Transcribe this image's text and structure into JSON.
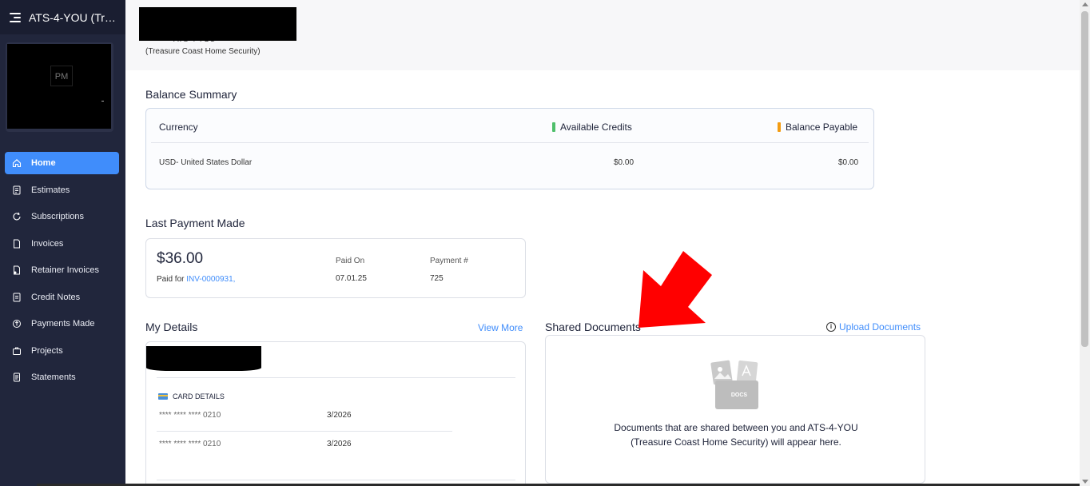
{
  "app": {
    "title": "ATS-4-YOU (Tre..."
  },
  "sidebar": {
    "logo_initials": "PM",
    "items": [
      {
        "label": "Home",
        "icon": "home-icon",
        "active": true
      },
      {
        "label": "Estimates",
        "icon": "estimates-icon",
        "active": false
      },
      {
        "label": "Subscriptions",
        "icon": "subscriptions-icon",
        "active": false
      },
      {
        "label": "Invoices",
        "icon": "invoices-icon",
        "active": false
      },
      {
        "label": "Retainer Invoices",
        "icon": "retainer-invoices-icon",
        "active": false
      },
      {
        "label": "Credit Notes",
        "icon": "credit-notes-icon",
        "active": false
      },
      {
        "label": "Payments Made",
        "icon": "payments-made-icon",
        "active": false
      },
      {
        "label": "Projects",
        "icon": "projects-icon",
        "active": false
      },
      {
        "label": "Statements",
        "icon": "statements-icon",
        "active": false
      }
    ]
  },
  "header": {
    "org_short": "ATS-4-YOU",
    "org_full": "(Treasure Coast Home Security)"
  },
  "balance_summary": {
    "title": "Balance Summary",
    "col_currency": "Currency",
    "col_credits": "Available Credits",
    "col_payable": "Balance Payable",
    "row": {
      "currency": "USD- United States Dollar",
      "credits": "$0.00",
      "payable": "$0.00"
    },
    "colors": {
      "credits_marker": "#4fbf6b",
      "payable_marker": "#f39c12"
    }
  },
  "last_payment": {
    "title": "Last Payment Made",
    "amount": "$36.00",
    "paid_for_label": "Paid for",
    "invoice": "INV-0000931,",
    "paid_on_label": "Paid On",
    "paid_on": "07.01.25",
    "payment_no_label": "Payment #",
    "payment_no": "725"
  },
  "my_details": {
    "title": "My Details",
    "view_more": "View More",
    "card_details_label": "CARD DETAILS",
    "cards": [
      {
        "number": "**** **** **** 0210",
        "expiry": "3/2026"
      },
      {
        "number": "**** **** **** 0210",
        "expiry": "3/2026"
      }
    ]
  },
  "shared_documents": {
    "title": "Shared Documents",
    "upload_label": "Upload Documents",
    "empty_badge": "DOCS",
    "empty_text": "Documents that are shared between you and ATS-4-YOU (Treasure Coast Home Security) will appear here."
  },
  "colors": {
    "accent": "#408dfb",
    "sidebar_bg": "#21263c",
    "arrow": "#ff0000"
  }
}
